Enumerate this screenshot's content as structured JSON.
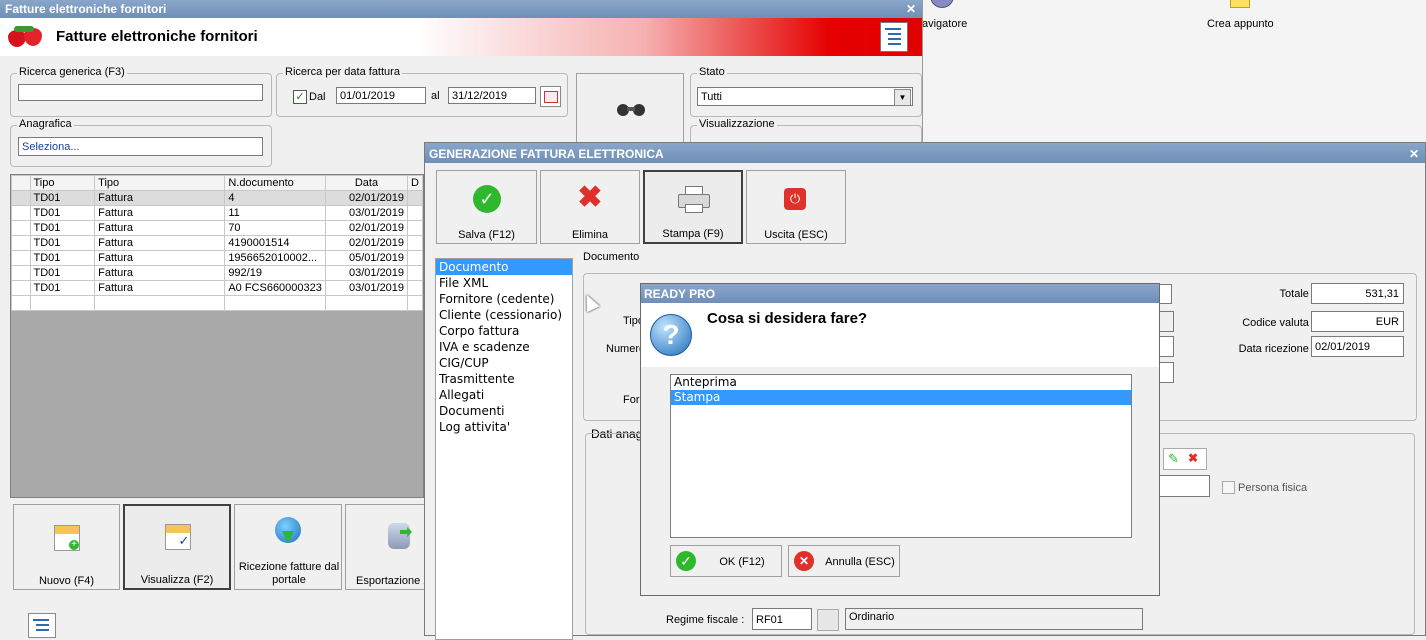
{
  "desktop": {
    "items": [
      {
        "label": "avigatore"
      },
      {
        "label": "Crea appunto"
      }
    ]
  },
  "main": {
    "window_title": "Fatture elettroniche fornitori",
    "header_title": "Fatture elettroniche fornitori",
    "search": {
      "label": "Ricerca generica (F3)",
      "value": ""
    },
    "date_search": {
      "label": "Ricerca per data fattura",
      "checkbox_label": "Dal",
      "from": "01/01/2019",
      "to_label": "al",
      "to": "31/12/2019"
    },
    "stato": {
      "label": "Stato",
      "value": "Tutti"
    },
    "visualizzazione": {
      "label": "Visualizzazione"
    },
    "anagrafica": {
      "label": "Anagrafica",
      "value": "Seleziona..."
    },
    "grid": {
      "columns": [
        "Tipo",
        "Tipo",
        "N.documento",
        "Data",
        "D"
      ],
      "rows": [
        [
          "TD01",
          "Fattura",
          "4",
          "02/01/2019"
        ],
        [
          "TD01",
          "Fattura",
          "11",
          "03/01/2019"
        ],
        [
          "TD01",
          "Fattura",
          "70",
          "02/01/2019"
        ],
        [
          "TD01",
          "Fattura",
          "4190001514",
          "02/01/2019"
        ],
        [
          "TD01",
          "Fattura",
          "1956652010002...",
          "05/01/2019"
        ],
        [
          "TD01",
          "Fattura",
          "992/19",
          "03/01/2019"
        ],
        [
          "TD01",
          "Fattura",
          "A0 FCS660000323",
          "03/01/2019"
        ]
      ]
    },
    "buttons": {
      "nuovo": "Nuovo (F4)",
      "visualizza": "Visualizza (F2)",
      "ricezione": "Ricezione fatture dal portale",
      "esportazione": "Esportazione X"
    }
  },
  "gen": {
    "title": "GENERAZIONE FATTURA ELETTRONICA",
    "toolbar": {
      "salva": "Salva (F12)",
      "elimina": "Elimina",
      "stampa": "Stampa (F9)",
      "uscita": "Uscita (ESC)"
    },
    "nav": [
      "Documento",
      "File XML",
      "Fornitore (cedente)",
      "Cliente (cessionario)",
      "Corpo fattura",
      "IVA e scadenze",
      "CIG/CUP",
      "Trasmittente",
      "Allegati",
      "Documenti",
      "Log attivita'"
    ],
    "documento_label": "Documento",
    "tipo_label": "Tipo",
    "numero_label": "Numero",
    "forn_label": "Forn",
    "dati_anag_label": "Dati anag",
    "totale": {
      "label": "Totale :",
      "value": "531,31"
    },
    "valuta": {
      "label": "Codice valuta :",
      "value": "EUR"
    },
    "ricezione": {
      "label": "Data ricezione :",
      "value": "02/01/2019"
    },
    "persona_fisica": "Persona fisica",
    "regime": {
      "label": "Regime fiscale :",
      "code": "RF01",
      "desc": "Ordinario"
    }
  },
  "dialog": {
    "title": "READY PRO",
    "question": "Cosa si desidera fare?",
    "options": [
      "Anteprima",
      "Stampa"
    ],
    "ok": "OK (F12)",
    "annulla": "Annulla (ESC)"
  }
}
